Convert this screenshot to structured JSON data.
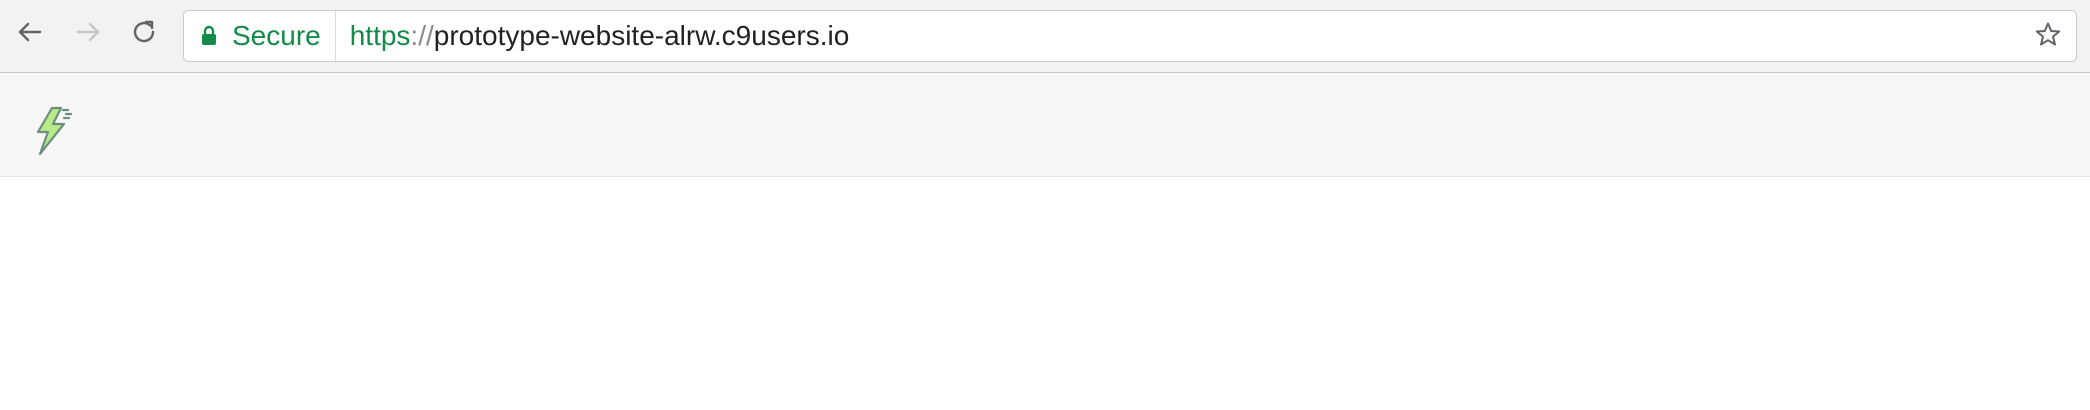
{
  "browser": {
    "nav_buttons": {
      "back": {
        "icon": "back-arrow-icon",
        "enabled": true
      },
      "forward": {
        "icon": "forward-arrow-icon",
        "enabled": false
      },
      "reload": {
        "icon": "reload-icon",
        "enabled": true
      }
    },
    "omnibox": {
      "secure_label": "Secure",
      "lock_icon": "lock-icon",
      "url_scheme": "https",
      "url_separator": "://",
      "url_host": "prototype-website-alrw.c9users.io",
      "bookmark_icon": "star-outline-icon"
    },
    "colors": {
      "secure_green": "#138b48",
      "toolbar_bg": "#f2f2f2",
      "navbar_bg": "#f7f7f7"
    }
  },
  "site": {
    "navbar": {
      "logo_icon": "lightning-bolt-icon",
      "logo_colors": {
        "fill": "#b8ea88",
        "stroke": "#6b8f7f"
      }
    }
  }
}
